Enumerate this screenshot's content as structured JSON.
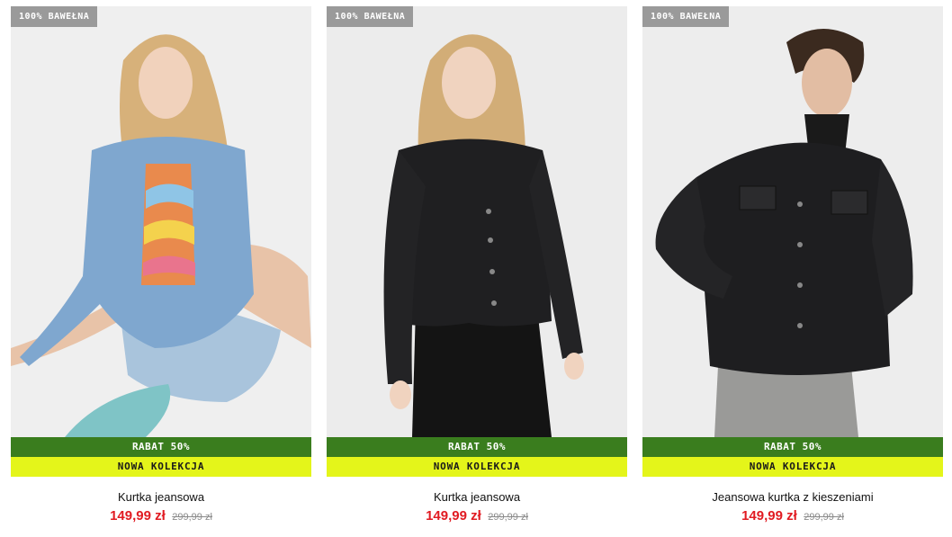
{
  "colors": {
    "badge_bg": "#9a9a9a",
    "discount_bg": "#3a7d1e",
    "new_bg": "#e4f51a",
    "price_now": "#e11b22",
    "price_old": "#8a8a8a"
  },
  "products": [
    {
      "badge": "100% BAWEŁNA",
      "discount": "RABAT 50%",
      "collection": "NOWA KOLEKCJA",
      "name": "Kurtka jeansowa",
      "price_now": "149,99 zł",
      "price_old": "299,99 zł"
    },
    {
      "badge": "100% BAWEŁNA",
      "discount": "RABAT 50%",
      "collection": "NOWA KOLEKCJA",
      "name": "Kurtka jeansowa",
      "price_now": "149,99 zł",
      "price_old": "299,99 zł"
    },
    {
      "badge": "100% BAWEŁNA",
      "discount": "RABAT 50%",
      "collection": "NOWA KOLEKCJA",
      "name": "Jeansowa kurtka z kieszeniami",
      "price_now": "149,99 zł",
      "price_old": "299,99 zł"
    }
  ]
}
